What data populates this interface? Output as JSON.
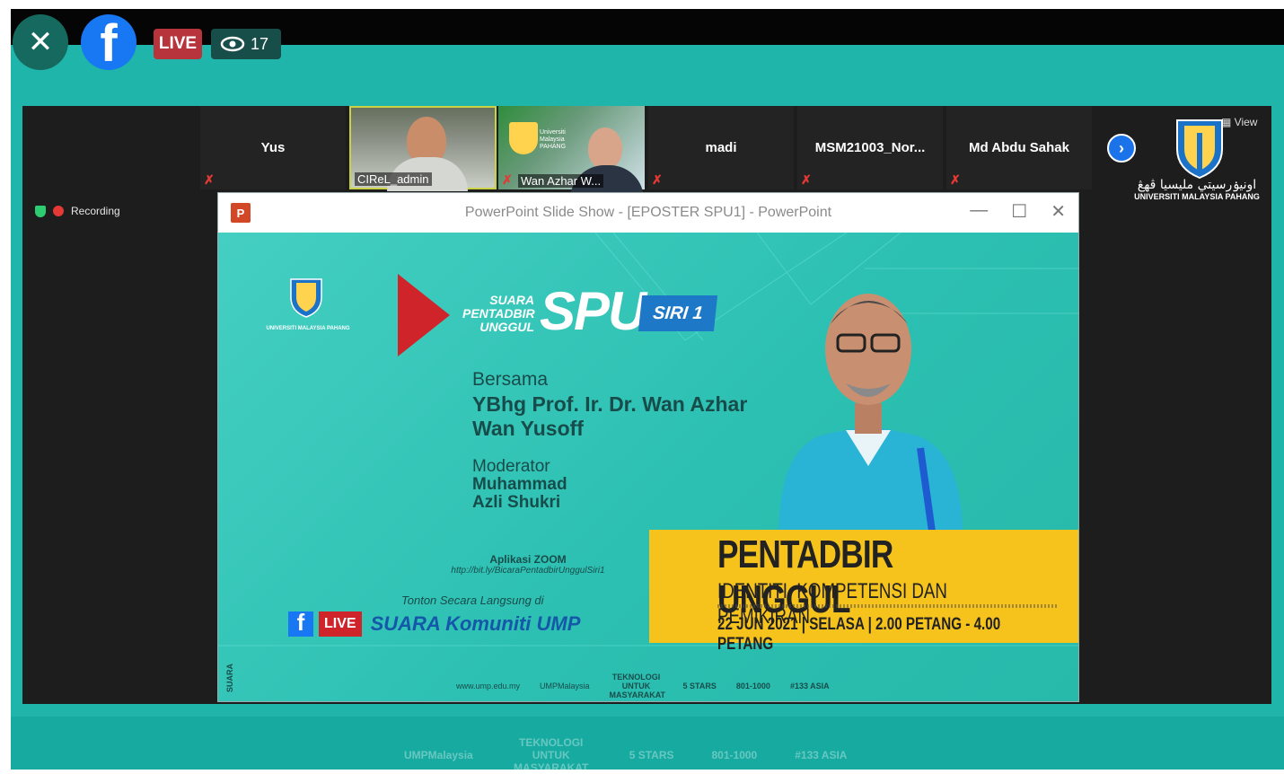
{
  "facebook": {
    "close_icon": "close-icon",
    "logo_letter": "f",
    "live_label": "LIVE",
    "viewer_count": "17"
  },
  "zoom": {
    "participants": [
      {
        "name": "Yus",
        "muted": true
      },
      {
        "name": "CIReL_admin",
        "video": true
      },
      {
        "name": "Wan Azhar W...",
        "video": true,
        "muted": true
      },
      {
        "name": "madi",
        "muted": true
      },
      {
        "name": "MSM21003_Nor...",
        "muted": true
      },
      {
        "name": "Md Abdu Sahak",
        "muted": true
      }
    ],
    "view_label": "View",
    "recording_label": "Recording",
    "org_jawi": "اونيۏرسيتي مليسيا ڤهڠ",
    "org_name": "UNIVERSITI MALAYSIA PAHANG",
    "next_icon": "chevron-right-icon"
  },
  "powerpoint": {
    "title": "PowerPoint Slide Show - [EPOSTER SPU1] - PowerPoint",
    "icon_letter": "P"
  },
  "slide": {
    "logo_text": "UNIVERSITI MALAYSIA PAHANG",
    "suara_line1": "SUARA",
    "suara_line2": "PENTADBIR",
    "suara_line3": "UNGGUL",
    "spu": "SPU",
    "siri": "SIRI 1",
    "bersama": "Bersama",
    "speaker_line1": "YBhg Prof. Ir. Dr. Wan Azhar",
    "speaker_line2": "Wan Yusoff",
    "moderator_label": "Moderator",
    "moderator_line1": "Muhammad",
    "moderator_line2": "Azli Shukri",
    "aplikasi": "Aplikasi ZOOM",
    "link": "http://bit.ly/BicaraPentadbirUnggulSiri1",
    "tonton": "Tonton Secara Langsung di",
    "live": "LIVE",
    "komuniti": "SUARA Komuniti UMP",
    "headline": "PENTADBIR UNGGUL",
    "subheadline": "IDENTITI, KOMPETENSI DAN PEMIKIRAN",
    "date_line": "22 JUN 2021 | SELASA | 2.00 PETANG - 4.00 PETANG",
    "website": "www.ump.edu.my",
    "handle": "UMPMalaysia",
    "teknologi": "TEKNOLOGI UNTUK MASYARAKAT",
    "stars": "5 STARS",
    "rank": "801-1000",
    "asia": "#133 ASIA",
    "vertical": "SUARA"
  },
  "outer_footer": {
    "handle": "UMPMalaysia",
    "teknologi": "TEKNOLOGI UNTUK MASYARAKAT",
    "stars": "5 STARS",
    "rank": "801-1000",
    "asia": "#133 ASIA"
  }
}
